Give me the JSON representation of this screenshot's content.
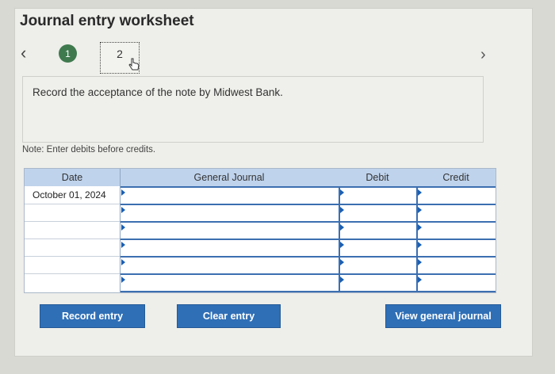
{
  "worksheet": {
    "title": "Journal entry worksheet",
    "prev_icon": "chevron-left-icon",
    "next_icon": "chevron-right-icon",
    "steps": [
      {
        "label": "1",
        "state": "completed"
      },
      {
        "label": "2",
        "state": "current"
      }
    ],
    "instruction": "Record the acceptance of the note by Midwest Bank.",
    "note": "Note: Enter debits before credits."
  },
  "table": {
    "headers": {
      "date": "Date",
      "general_journal": "General Journal",
      "debit": "Debit",
      "credit": "Credit"
    },
    "rows": [
      {
        "date": "October 01, 2024",
        "account": "",
        "debit": "",
        "credit": ""
      },
      {
        "date": "",
        "account": "",
        "debit": "",
        "credit": ""
      },
      {
        "date": "",
        "account": "",
        "debit": "",
        "credit": ""
      },
      {
        "date": "",
        "account": "",
        "debit": "",
        "credit": ""
      },
      {
        "date": "",
        "account": "",
        "debit": "",
        "credit": ""
      },
      {
        "date": "",
        "account": "",
        "debit": "",
        "credit": ""
      }
    ]
  },
  "buttons": {
    "record_entry": "Record entry",
    "clear_entry": "Clear entry",
    "view_general_journal": "View general journal"
  },
  "colors": {
    "header_bg": "#bfd3ec",
    "button_bg": "#2f6fb6",
    "step_done": "#3f7a4e"
  }
}
